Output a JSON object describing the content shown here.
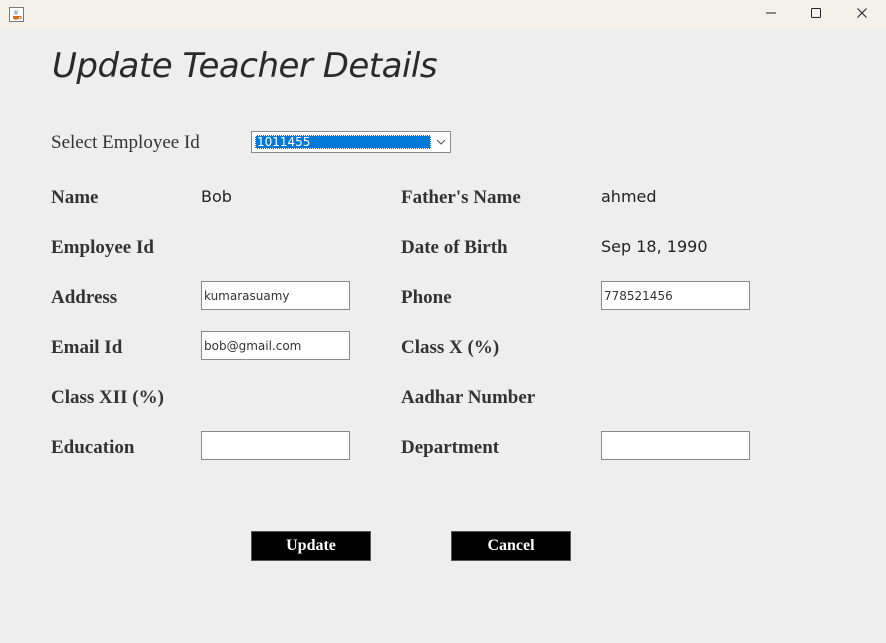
{
  "window": {
    "icon": "java-cup-icon",
    "controls": [
      "minimize-icon",
      "maximize-icon",
      "close-icon"
    ]
  },
  "form": {
    "heading": "Update Teacher Details",
    "employee_select": {
      "label": "Select Employee Id",
      "selected": "1011455"
    },
    "fields": {
      "name": {
        "label": "Name",
        "value": "Bob"
      },
      "fathers_name": {
        "label": "Father's Name",
        "value": "ahmed"
      },
      "employee_id": {
        "label": "Employee Id",
        "value": ""
      },
      "dob": {
        "label": "Date of Birth",
        "value": "Sep 18, 1990"
      },
      "address": {
        "label": "Address",
        "value": "kumarasuamy"
      },
      "phone": {
        "label": "Phone",
        "value": "778521456"
      },
      "email": {
        "label": "Email Id",
        "value": "bob@gmail.com"
      },
      "class_x": {
        "label": "Class X (%)",
        "value": ""
      },
      "class_xii": {
        "label": "Class XII (%)",
        "value": ""
      },
      "aadhar": {
        "label": "Aadhar Number",
        "value": ""
      },
      "education": {
        "label": "Education",
        "value": ""
      },
      "department": {
        "label": "Department",
        "value": ""
      }
    },
    "buttons": {
      "update": "Update",
      "cancel": "Cancel"
    }
  },
  "colors": {
    "background": "#eeeeee",
    "selection": "#0078d7",
    "button_bg": "#000000",
    "button_text": "#ffffff"
  }
}
